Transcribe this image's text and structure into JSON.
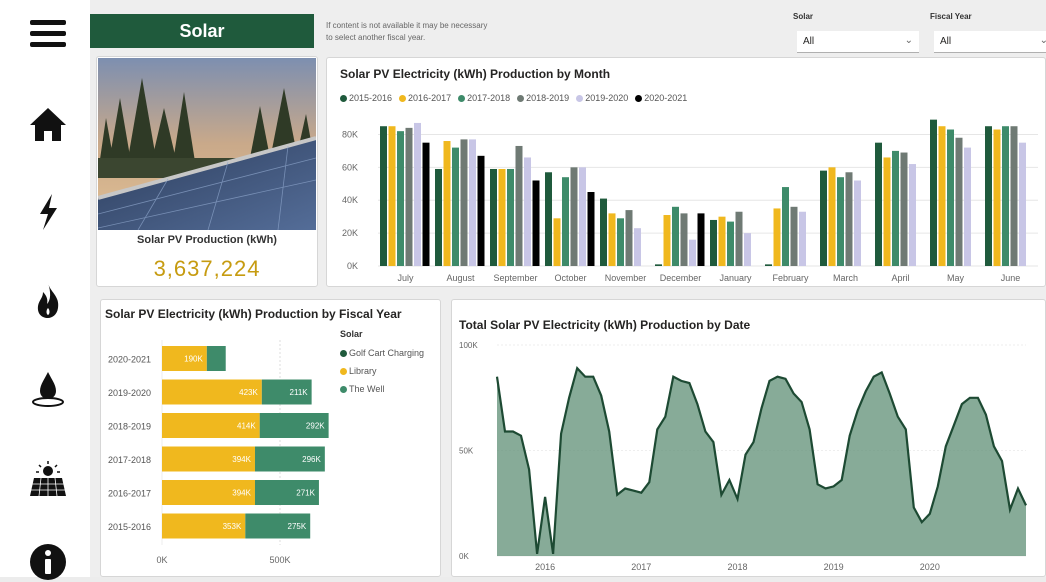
{
  "page": {
    "title": "Solar",
    "note": [
      "If content is not available it may be necessary",
      "to select another fiscal year."
    ]
  },
  "filters": [
    {
      "label": "Solar",
      "value": "All"
    },
    {
      "label": "Fiscal Year",
      "value": "All"
    }
  ],
  "nav": [
    {
      "name": "menu-icon"
    },
    {
      "name": "home-icon"
    },
    {
      "name": "lightning-icon"
    },
    {
      "name": "flame-icon"
    },
    {
      "name": "water-drop-icon"
    },
    {
      "name": "solar-panel-icon"
    },
    {
      "name": "info-icon"
    }
  ],
  "kpi": {
    "label": "Solar PV Production (kWh)",
    "value": "3,637,224",
    "color": "#c69b10"
  },
  "chart_data": [
    {
      "type": "bar",
      "title": "Solar PV Electricity (kWh) Production by Month",
      "categories": [
        "July",
        "August",
        "September",
        "October",
        "November",
        "December",
        "January",
        "February",
        "March",
        "April",
        "May",
        "June"
      ],
      "ylim": [
        0,
        90000
      ],
      "yticks": [
        "0K",
        "20K",
        "40K",
        "60K",
        "80K"
      ],
      "series": [
        {
          "name": "2015-2016",
          "color": "#1f5a3c",
          "values": [
            85000,
            59000,
            59000,
            57000,
            41000,
            1000,
            28000,
            1000,
            58000,
            75000,
            89000,
            85000
          ]
        },
        {
          "name": "2016-2017",
          "color": "#f0b81e",
          "values": [
            85000,
            76000,
            59000,
            29000,
            32000,
            31000,
            30000,
            35000,
            60000,
            66000,
            85000,
            83000
          ]
        },
        {
          "name": "2017-2018",
          "color": "#3e8b6a",
          "values": [
            82000,
            72000,
            59000,
            54000,
            29000,
            36000,
            27000,
            48000,
            54000,
            70000,
            83000,
            85000
          ]
        },
        {
          "name": "2018-2019",
          "color": "#6f7a74",
          "values": [
            84000,
            77000,
            73000,
            60000,
            34000,
            32000,
            33000,
            36000,
            57000,
            69000,
            78000,
            85000
          ]
        },
        {
          "name": "2019-2020",
          "color": "#c8c6e6",
          "values": [
            87000,
            77000,
            66000,
            60000,
            23000,
            16000,
            20000,
            33000,
            52000,
            62000,
            72000,
            75000
          ]
        },
        {
          "name": "2020-2021",
          "color": "#000000",
          "values": [
            75000,
            67000,
            52000,
            45000,
            null,
            32000,
            null,
            null,
            null,
            null,
            null,
            null
          ]
        }
      ]
    },
    {
      "type": "bar",
      "orientation": "horizontal",
      "stacked": true,
      "title": "Solar PV Electricity (kWh) Production by Fiscal Year",
      "legend_title": "Solar",
      "categories": [
        "2020-2021",
        "2019-2020",
        "2018-2019",
        "2017-2018",
        "2016-2017",
        "2015-2016"
      ],
      "xticks": [
        "0K",
        "500K"
      ],
      "xlim": [
        0,
        750000
      ],
      "series": [
        {
          "name": "Golf Cart Charging",
          "color": "#1f5a3c",
          "values": [
            0,
            0,
            0,
            0,
            0,
            0
          ],
          "labels": [
            "",
            "",
            "",
            "",
            "",
            ""
          ]
        },
        {
          "name": "Library",
          "color": "#f0b81e",
          "values": [
            190000,
            423000,
            414000,
            394000,
            394000,
            353000
          ],
          "labels": [
            "190K",
            "423K",
            "414K",
            "394K",
            "394K",
            "353K"
          ]
        },
        {
          "name": "The Well",
          "color": "#3e8b6a",
          "values": [
            80000,
            211000,
            292000,
            296000,
            271000,
            275000
          ],
          "labels": [
            "",
            "211K",
            "292K",
            "296K",
            "271K",
            "275K"
          ]
        }
      ]
    },
    {
      "type": "area",
      "title": "Total Solar PV Electricity (kWh) Production by Date",
      "ylim": [
        0,
        100000
      ],
      "yticks": [
        "0K",
        "50K",
        "100K"
      ],
      "xticks": [
        "2016",
        "2017",
        "2018",
        "2019",
        "2020"
      ],
      "color": "#5f8f76",
      "line_color": "#1d4a33",
      "x": [
        "2015-07",
        "2015-08",
        "2015-09",
        "2015-10",
        "2015-11",
        "2015-12",
        "2016-01",
        "2016-02",
        "2016-03",
        "2016-04",
        "2016-05",
        "2016-06",
        "2016-07",
        "2016-08",
        "2016-09",
        "2016-10",
        "2016-11",
        "2016-12",
        "2017-01",
        "2017-02",
        "2017-03",
        "2017-04",
        "2017-05",
        "2017-06",
        "2017-07",
        "2017-08",
        "2017-09",
        "2017-10",
        "2017-11",
        "2017-12",
        "2018-01",
        "2018-02",
        "2018-03",
        "2018-04",
        "2018-05",
        "2018-06",
        "2018-07",
        "2018-08",
        "2018-09",
        "2018-10",
        "2018-11",
        "2018-12",
        "2019-01",
        "2019-02",
        "2019-03",
        "2019-04",
        "2019-05",
        "2019-06",
        "2019-07",
        "2019-08",
        "2019-09",
        "2019-10",
        "2019-11",
        "2019-12",
        "2020-01",
        "2020-02",
        "2020-03",
        "2020-04",
        "2020-05",
        "2020-06",
        "2020-07",
        "2020-08",
        "2020-09",
        "2020-10",
        "2020-11",
        "2020-12",
        "2021-01"
      ],
      "values": [
        85000,
        59000,
        59000,
        57000,
        41000,
        1000,
        28000,
        1000,
        58000,
        75000,
        89000,
        85000,
        85000,
        76000,
        59000,
        29000,
        32000,
        31000,
        30000,
        35000,
        60000,
        66000,
        85000,
        83000,
        82000,
        72000,
        59000,
        54000,
        29000,
        36000,
        27000,
        48000,
        54000,
        70000,
        83000,
        85000,
        84000,
        77000,
        73000,
        60000,
        34000,
        32000,
        33000,
        36000,
        57000,
        69000,
        78000,
        85000,
        87000,
        77000,
        66000,
        60000,
        23000,
        16000,
        20000,
        33000,
        52000,
        62000,
        72000,
        75000,
        75000,
        67000,
        52000,
        45000,
        22000,
        32000,
        24000
      ]
    }
  ]
}
